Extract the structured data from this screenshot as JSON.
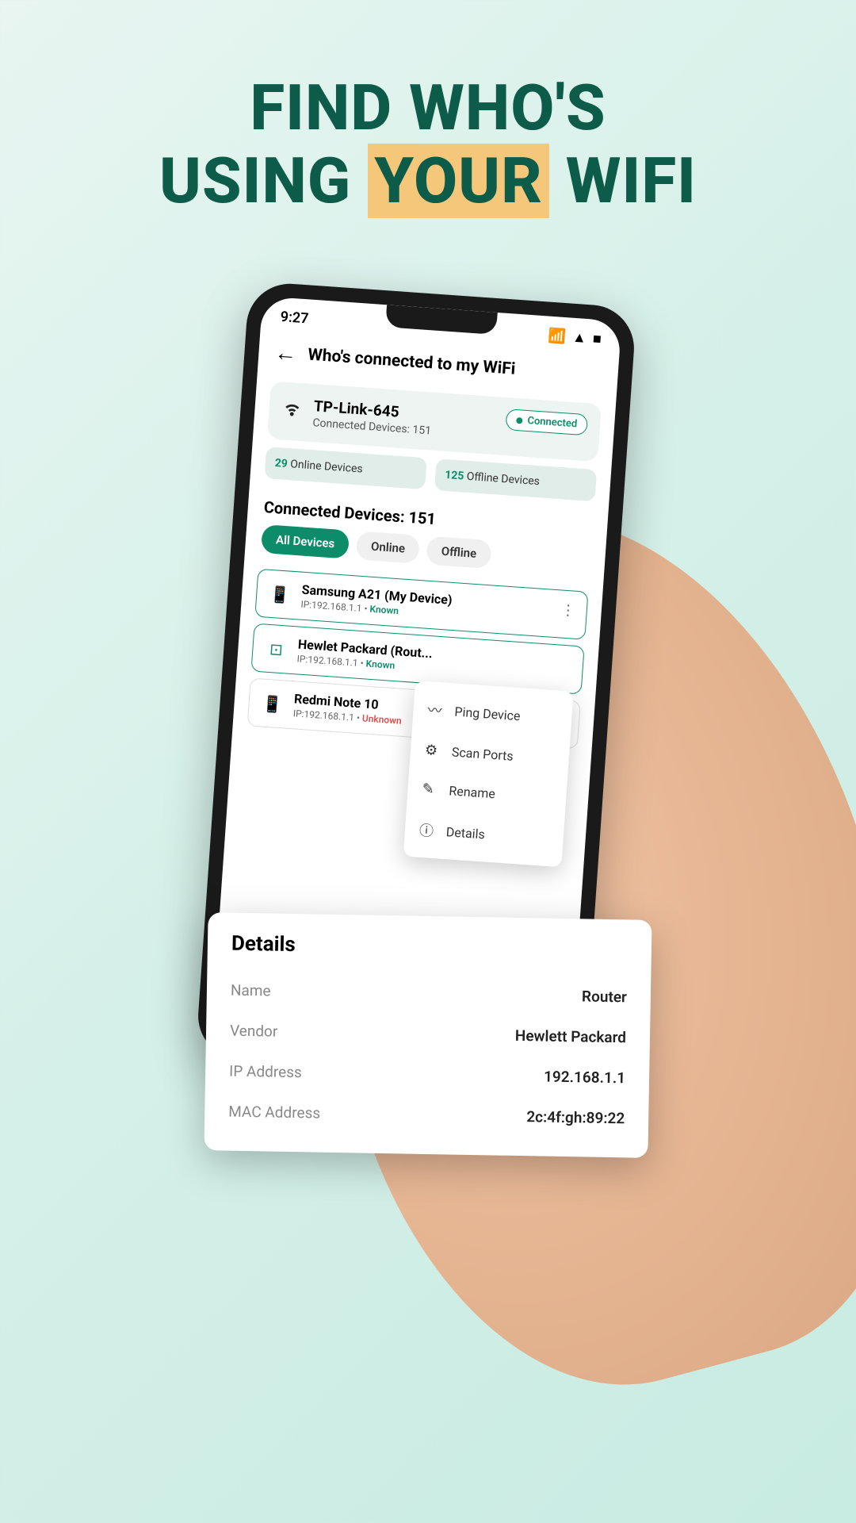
{
  "headline": {
    "line1": "FIND WHO'S",
    "line2_a": "USING",
    "line2_highlight": "YOUR",
    "line2_b": "WIFI"
  },
  "status": {
    "time": "9:27"
  },
  "app": {
    "title": "Who's connected to my WiFi"
  },
  "network": {
    "name": "TP-Link-645",
    "subtitle": "Connected Devices: 151",
    "status": "Connected"
  },
  "stats": {
    "online_count": "29",
    "online_label": "Online Devices",
    "offline_count": "125",
    "offline_label": "Offline Devices"
  },
  "section": {
    "title": "Connected Devices: 151"
  },
  "filters": {
    "all": "All Devices",
    "online": "Online",
    "offline": "Offline"
  },
  "devices": [
    {
      "name": "Samsung A21 (My Device)",
      "ip": "IP:192.168.1.1",
      "status": "Known",
      "status_type": "known"
    },
    {
      "name": "Hewlet Packard (Rout...",
      "ip": "IP:192.168.1.1",
      "status": "Known",
      "status_type": "known"
    },
    {
      "name": "Redmi Note 10",
      "ip": "IP:192.168.1.1",
      "status": "Unknown",
      "status_type": "unknown"
    }
  ],
  "menu": {
    "ping": "Ping Device",
    "scan": "Scan Ports",
    "rename": "Rename",
    "details": "Details"
  },
  "details": {
    "title": "Details",
    "rows": {
      "name_label": "Name",
      "name_value": "Router",
      "vendor_label": "Vendor",
      "vendor_value": "Hewlett Packard",
      "ip_label": "IP Address",
      "ip_value": "192.168.1.1",
      "mac_label": "MAC Address",
      "mac_value": "2c:4f:gh:89:22"
    }
  }
}
